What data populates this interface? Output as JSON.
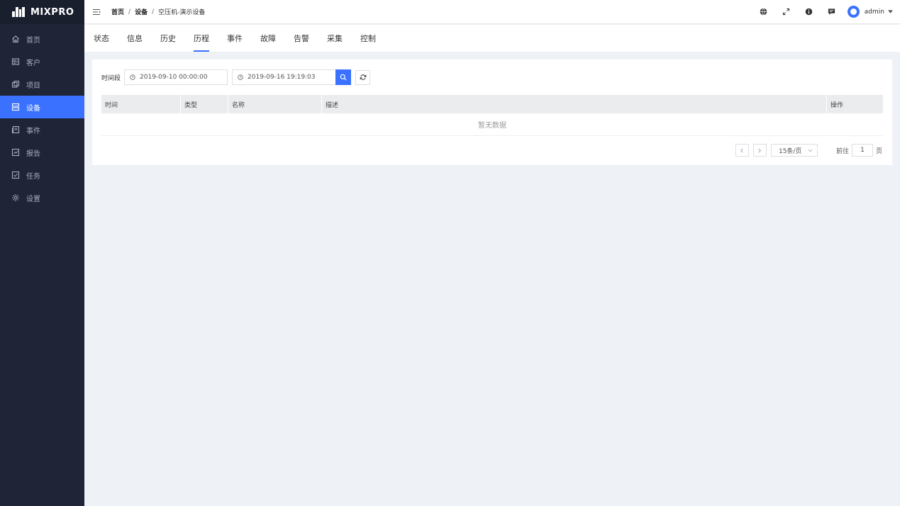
{
  "brand": {
    "name": "MIXPRO"
  },
  "sidebar": {
    "items": [
      {
        "label": "首页",
        "icon": "home-icon"
      },
      {
        "label": "客户",
        "icon": "customer-icon"
      },
      {
        "label": "项目",
        "icon": "project-icon"
      },
      {
        "label": "设备",
        "icon": "device-icon",
        "active": true
      },
      {
        "label": "事件",
        "icon": "event-icon"
      },
      {
        "label": "报告",
        "icon": "report-icon"
      },
      {
        "label": "任务",
        "icon": "task-icon"
      },
      {
        "label": "设置",
        "icon": "settings-icon"
      }
    ]
  },
  "header": {
    "breadcrumb": [
      "首页",
      "设备",
      "空压机-演示设备"
    ],
    "separator": "/",
    "user": "admin"
  },
  "tabs": [
    "状态",
    "信息",
    "历史",
    "历程",
    "事件",
    "故障",
    "告警",
    "采集",
    "控制"
  ],
  "active_tab": "历程",
  "filter": {
    "label": "时间段",
    "start": "2019-09-10 00:00:00",
    "end": "2019-09-16 19:19:03"
  },
  "table": {
    "columns": [
      "时间",
      "类型",
      "名称",
      "描述",
      "操作"
    ],
    "empty_text": "暂无数据"
  },
  "pagination": {
    "page_size": "15条/页",
    "goto_label": "前往",
    "current_page": "1",
    "page_suffix": "页"
  },
  "colors": {
    "accent": "#3a72ff",
    "sidebar_bg": "#1f2537",
    "page_bg": "#eef1f6"
  }
}
